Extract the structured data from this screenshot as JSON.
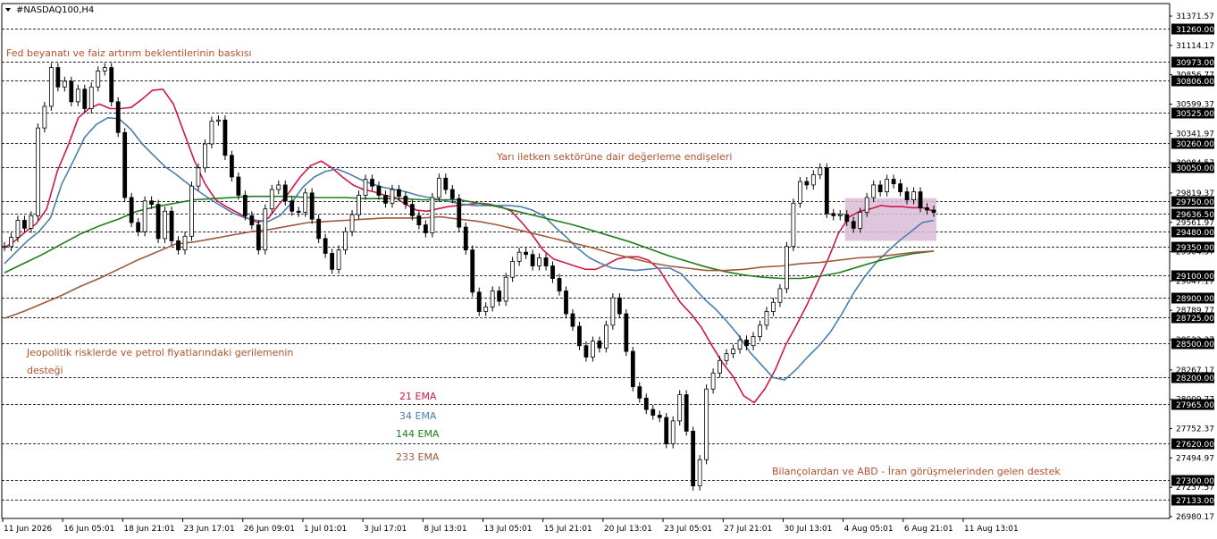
{
  "chart_data": {
    "type": "line",
    "title": "#NASDAQ100,H4",
    "x_ticks": [
      "11 Jun 2026",
      "16 Jun 05:01",
      "18 Jun 21:01",
      "23 Jun 17:01",
      "26 Jun 09:01",
      "1 Jul 01:01",
      "3 Jul 17:01",
      "8 Jul 13:01",
      "13 Jul 05:01",
      "15 Jul 21:01",
      "20 Jul 13:01",
      "23 Jul 05:01",
      "27 Jul 21:01",
      "30 Jul 13:01",
      "4 Aug 05:01",
      "6 Aug 21:01",
      "11 Aug 13:01"
    ],
    "y_ticks": [
      31371.57,
      31114.17,
      30856.77,
      30599.37,
      30341.97,
      30084.57,
      29819.37,
      29561.97,
      29304.57,
      29047.17,
      28789.77,
      28532.37,
      28267.17,
      28009.77,
      27752.37,
      27494.97,
      27237.57,
      26980.17
    ],
    "ylim": [
      26980.17,
      31371.57
    ],
    "levels": [
      31260.0,
      30973.0,
      30806.0,
      30525.0,
      30260.0,
      30050.0,
      29750.0,
      29636.5,
      29480.0,
      29350.0,
      29100.0,
      28900.0,
      28725.0,
      28500.0,
      28200.0,
      27965.0,
      27620.0,
      27300.0,
      27133.0
    ],
    "current_price_label": "29636.50",
    "price_series": [
      29350,
      29430,
      29580,
      29510,
      29620,
      30390,
      30580,
      30920,
      30750,
      30800,
      30620,
      30730,
      30560,
      30750,
      30890,
      30920,
      30620,
      30350,
      29780,
      29560,
      29480,
      29750,
      29720,
      29420,
      29660,
      29400,
      29320,
      29440,
      29880,
      30040,
      30250,
      30450,
      30460,
      30150,
      29960,
      29800,
      29620,
      29540,
      29320,
      29680,
      29850,
      29890,
      29750,
      29660,
      29650,
      29820,
      29590,
      29420,
      29290,
      29150,
      29320,
      29480,
      29630,
      29800,
      29940,
      29880,
      29800,
      29730,
      29850,
      29790,
      29720,
      29620,
      29540,
      29470,
      29780,
      29950,
      29850,
      29770,
      29520,
      29320,
      28950,
      28780,
      28820,
      28960,
      28870,
      29080,
      29220,
      29300,
      29280,
      29180,
      29250,
      29180,
      29070,
      28960,
      28760,
      28650,
      28480,
      28380,
      28520,
      28460,
      28660,
      28900,
      28760,
      28430,
      28120,
      28020,
      27920,
      27870,
      27850,
      27620,
      27820,
      28050,
      27730,
      27250,
      27480,
      28100,
      28240,
      28350,
      28410,
      28450,
      28530,
      28480,
      28560,
      28660,
      28780,
      28860,
      28980,
      29350,
      29730,
      29920,
      29890,
      29980,
      30040,
      29640,
      29620,
      29630,
      29570,
      29510,
      29650,
      29780,
      29890,
      29830,
      29940,
      29900,
      29830,
      29760,
      29830,
      29690,
      29670,
      29650
    ],
    "series": [
      {
        "name": "21 EMA",
        "color": "#d0174a",
        "values": [
          29340,
          29400,
          29480,
          29550,
          29680,
          30010,
          30230,
          30480,
          30560,
          30600,
          30560,
          30560,
          30570,
          30640,
          30720,
          30730,
          30600,
          30350,
          30100,
          29900,
          29760,
          29700,
          29650,
          29600,
          29560,
          29600,
          29720,
          29830,
          29960,
          30060,
          30100,
          30040,
          29960,
          29890,
          29850,
          29830,
          29800,
          29780,
          29720,
          29670,
          29660,
          29680,
          29700,
          29710,
          29720,
          29730,
          29720,
          29700,
          29660,
          29560,
          29450,
          29320,
          29240,
          29210,
          29180,
          29150,
          29150,
          29190,
          29240,
          29260,
          29260,
          29230,
          29150,
          29000,
          28860,
          28760,
          28640,
          28480,
          28330,
          28210,
          28040,
          27980,
          28100,
          28270,
          28490,
          28660,
          28840,
          29040,
          29240,
          29470,
          29610,
          29660,
          29680,
          29710,
          29700,
          29700,
          29690,
          29690,
          29660
        ]
      },
      {
        "name": "34 EMA",
        "color": "#4a7fae",
        "values": [
          29200,
          29300,
          29400,
          29480,
          29600,
          29900,
          30100,
          30310,
          30420,
          30480,
          30470,
          30380,
          30250,
          30150,
          30050,
          29980,
          29900,
          29830,
          29760,
          29700,
          29640,
          29600,
          29580,
          29570,
          29620,
          29730,
          29870,
          29960,
          30010,
          30030,
          29990,
          29940,
          29900,
          29870,
          29850,
          29830,
          29800,
          29780,
          29760,
          29740,
          29720,
          29710,
          29710,
          29710,
          29710,
          29700,
          29670,
          29620,
          29520,
          29430,
          29330,
          29250,
          29200,
          29160,
          29150,
          29140,
          29150,
          29160,
          29160,
          29110,
          29000,
          28890,
          28800,
          28690,
          28570,
          28420,
          28310,
          28200,
          28180,
          28270,
          28380,
          28480,
          28600,
          28760,
          28940,
          29090,
          29210,
          29310,
          29400,
          29480,
          29560,
          29580
        ]
      },
      {
        "name": "144 EMA",
        "color": "#1e7d1e",
        "values": [
          29120,
          29200,
          29280,
          29370,
          29460,
          29530,
          29590,
          29660,
          29700,
          29730,
          29760,
          29770,
          29780,
          29790,
          29790,
          29790,
          29780,
          29780,
          29780,
          29770,
          29770,
          29770,
          29760,
          29760,
          29760,
          29730,
          29700,
          29660,
          29620,
          29580,
          29540,
          29490,
          29440,
          29390,
          29330,
          29270,
          29220,
          29170,
          29130,
          29100,
          29080,
          29070,
          29070,
          29090,
          29120,
          29170,
          29220,
          29260,
          29290,
          29310
        ]
      },
      {
        "name": "233 EMA",
        "color": "#a05a3a",
        "values": [
          28720,
          28780,
          28850,
          28920,
          29000,
          29070,
          29150,
          29230,
          29300,
          29370,
          29390,
          29420,
          29450,
          29480,
          29500,
          29530,
          29560,
          29570,
          29580,
          29590,
          29600,
          29600,
          29600,
          29610,
          29590,
          29570,
          29540,
          29500,
          29460,
          29420,
          29380,
          29340,
          29290,
          29250,
          29210,
          29180,
          29160,
          29140,
          29140,
          29150,
          29170,
          29180,
          29200,
          29210,
          29230,
          29250,
          29260,
          29280,
          29300,
          29310
        ]
      }
    ],
    "rectangle": {
      "y_range": [
        29400,
        29775
      ],
      "x_span_ticks": [
        "4 Aug 05:01",
        "11 Aug 13:01"
      ]
    },
    "annotations": [
      "Fed beyanatı ve faiz artırım beklentilerinin baskısı",
      "Yarı iletken sektörüne dair değerleme endişeleri",
      "Jeopolitik risklerde ve petrol fiyatlarındaki gerilemenin",
      "desteği",
      "Bilançolardan ve ABD - İran görüşmelerinden gelen destek"
    ],
    "legend": [
      {
        "label": "21 EMA",
        "color": "#d0174a"
      },
      {
        "label": "34 EMA",
        "color": "#4a7fae"
      },
      {
        "label": "144 EMA",
        "color": "#1e7d1e"
      },
      {
        "label": "233 EMA",
        "color": "#a05a3a"
      }
    ],
    "grid": false,
    "colors": {
      "background": "#ffffff",
      "axis": "#000000",
      "level_line": "#2c2c2c",
      "annotation": "#b5502a",
      "rectangle_fill": "#d9bcd6",
      "label_box": "#000000",
      "label_text": "#ffffff"
    }
  }
}
